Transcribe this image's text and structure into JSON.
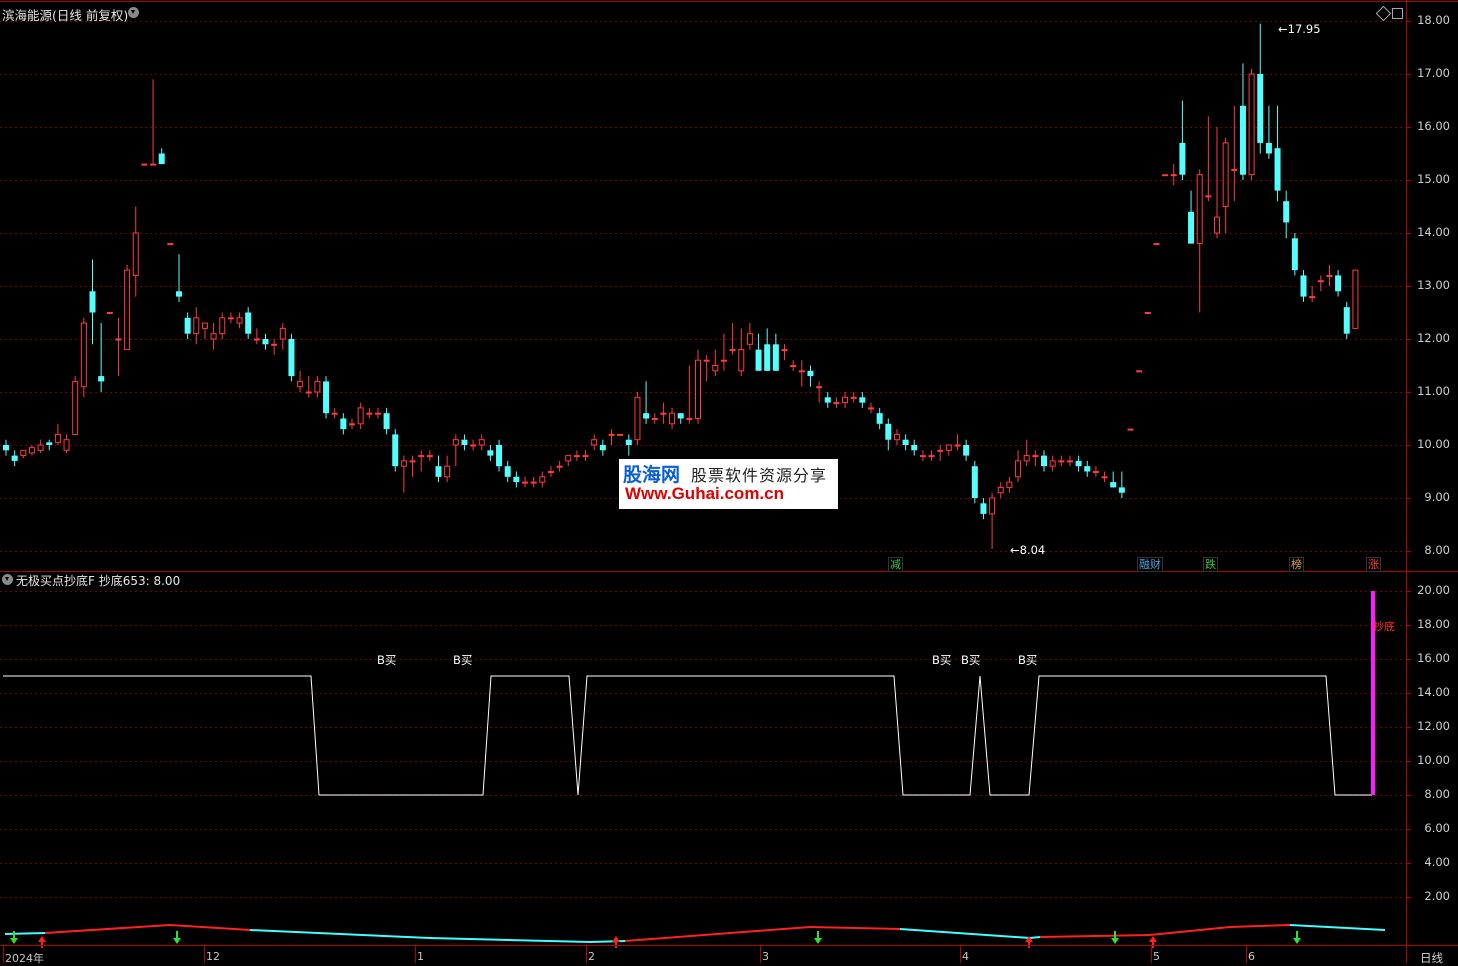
{
  "window": {
    "title": "滨海能源(日线 前复权)",
    "period_label": "日线"
  },
  "price_axis": [
    "18.00",
    "17.00",
    "16.00",
    "15.00",
    "14.00",
    "13.00",
    "12.00",
    "11.00",
    "10.00",
    "9.00",
    "8.00"
  ],
  "indicator_axis": [
    "20.00",
    "18.00",
    "16.00",
    "14.00",
    "12.00",
    "10.00",
    "8.00",
    "6.00",
    "4.00",
    "2.00"
  ],
  "price_annotations": {
    "high": "17.95",
    "low": "8.04"
  },
  "event_tags": [
    {
      "text": "减",
      "color": "#3cc34a"
    },
    {
      "text": "融财",
      "color": "#4fa0e0"
    },
    {
      "text": "跌",
      "color": "#3cc34a"
    },
    {
      "text": "榜",
      "color": "#e0a040"
    },
    {
      "text": "涨",
      "color": "#ff4040"
    }
  ],
  "indicator": {
    "title": "无极买点抄底F  抄底653: 8.00",
    "series_label": "抄底",
    "buy_label": "B买"
  },
  "x_axis_labels": [
    "2024年",
    "12",
    "1",
    "2",
    "3",
    "4",
    "5",
    "6"
  ],
  "watermark": {
    "logo": "股海网",
    "tagline": "股票软件资源分享",
    "url": "Www.Guhai.com.cn"
  },
  "colors": {
    "up": "#ff3b3b",
    "down": "#54ffff",
    "grid": "#7a0000",
    "axis": "#b00000",
    "indicator_line": "#ffffff",
    "signal": "#ff1aff"
  },
  "chart_data": {
    "type": "candlestick",
    "title": "滨海能源(日线 前复权)",
    "ylim": [
      8.0,
      18.0
    ],
    "candles": [
      [
        10.0,
        9.9,
        10.1,
        9.8
      ],
      [
        9.8,
        9.7,
        9.9,
        9.6
      ],
      [
        9.8,
        9.9,
        9.9,
        9.75
      ],
      [
        9.85,
        9.95,
        10.0,
        9.8
      ],
      [
        9.9,
        10.0,
        10.1,
        9.85
      ],
      [
        10.05,
        10.0,
        10.1,
        9.9
      ],
      [
        10.05,
        10.2,
        10.4,
        10.0
      ],
      [
        9.9,
        10.1,
        10.2,
        9.85
      ],
      [
        10.2,
        11.2,
        11.3,
        10.2
      ],
      [
        11.1,
        12.3,
        12.4,
        10.9
      ],
      [
        12.9,
        12.5,
        13.5,
        11.9
      ],
      [
        11.3,
        11.2,
        12.3,
        11.0
      ],
      [
        12.5,
        12.5,
        12.5,
        12.5
      ],
      [
        12.0,
        12.0,
        12.4,
        11.3
      ],
      [
        11.8,
        13.3,
        13.4,
        11.8
      ],
      [
        13.2,
        14.0,
        14.5,
        12.8
      ],
      [
        15.3,
        15.3,
        15.3,
        15.3
      ],
      [
        15.3,
        15.3,
        16.9,
        15.3
      ],
      [
        15.5,
        15.3,
        15.6,
        15.3
      ],
      [
        13.8,
        13.8,
        13.8,
        13.8
      ],
      [
        12.9,
        12.8,
        13.6,
        12.7
      ],
      [
        12.4,
        12.1,
        12.5,
        12.0
      ],
      [
        12.1,
        12.4,
        12.6,
        11.9
      ],
      [
        12.2,
        12.3,
        12.3,
        12.0
      ],
      [
        12.0,
        12.1,
        12.3,
        11.8
      ],
      [
        12.1,
        12.4,
        12.5,
        12.0
      ],
      [
        12.4,
        12.4,
        12.5,
        12.3
      ],
      [
        12.3,
        12.4,
        12.5,
        12.2
      ],
      [
        12.5,
        12.1,
        12.6,
        12.0
      ],
      [
        12.0,
        12.0,
        12.2,
        11.9
      ],
      [
        12.0,
        11.9,
        12.1,
        11.8
      ],
      [
        11.9,
        11.9,
        12.0,
        11.7
      ],
      [
        12.0,
        12.2,
        12.3,
        11.8
      ],
      [
        12.0,
        11.3,
        12.1,
        11.2
      ],
      [
        11.1,
        11.2,
        11.4,
        11.0
      ],
      [
        11.0,
        11.0,
        11.3,
        10.9
      ],
      [
        11.0,
        11.2,
        11.3,
        10.9
      ],
      [
        11.2,
        10.6,
        11.3,
        10.5
      ],
      [
        10.6,
        10.6,
        10.7,
        10.5
      ],
      [
        10.5,
        10.3,
        10.6,
        10.2
      ],
      [
        10.4,
        10.4,
        10.5,
        10.3
      ],
      [
        10.4,
        10.7,
        10.8,
        10.3
      ],
      [
        10.6,
        10.6,
        10.7,
        10.5
      ],
      [
        10.6,
        10.6,
        10.7,
        10.5
      ],
      [
        10.6,
        10.3,
        10.7,
        10.2
      ],
      [
        10.2,
        9.6,
        10.3,
        9.5
      ],
      [
        9.6,
        9.7,
        9.8,
        9.1
      ],
      [
        9.7,
        9.7,
        9.8,
        9.4
      ],
      [
        9.8,
        9.8,
        9.9,
        9.5
      ],
      [
        9.8,
        9.8,
        9.9,
        9.7
      ],
      [
        9.6,
        9.4,
        9.8,
        9.3
      ],
      [
        9.4,
        9.6,
        9.8,
        9.3
      ],
      [
        10.0,
        10.1,
        10.2,
        9.6
      ],
      [
        10.1,
        10.0,
        10.2,
        9.9
      ],
      [
        10.0,
        10.0,
        10.1,
        9.9
      ],
      [
        10.0,
        10.1,
        10.2,
        9.9
      ],
      [
        9.9,
        9.8,
        10.0,
        9.7
      ],
      [
        10.0,
        9.6,
        10.1,
        9.5
      ],
      [
        9.6,
        9.4,
        9.7,
        9.3
      ],
      [
        9.4,
        9.3,
        9.5,
        9.2
      ],
      [
        9.3,
        9.3,
        9.4,
        9.2
      ],
      [
        9.3,
        9.3,
        9.4,
        9.2
      ],
      [
        9.3,
        9.4,
        9.5,
        9.2
      ],
      [
        9.5,
        9.5,
        9.6,
        9.4
      ],
      [
        9.6,
        9.6,
        9.7,
        9.5
      ],
      [
        9.7,
        9.8,
        9.8,
        9.6
      ],
      [
        9.8,
        9.8,
        9.9,
        9.7
      ],
      [
        9.8,
        9.8,
        9.9,
        9.7
      ],
      [
        10.0,
        10.1,
        10.2,
        9.9
      ],
      [
        10.0,
        9.9,
        10.1,
        9.8
      ],
      [
        10.2,
        10.2,
        10.3,
        10.0
      ],
      [
        10.2,
        10.2,
        10.2,
        10.2
      ],
      [
        10.1,
        10.0,
        10.2,
        9.8
      ],
      [
        10.1,
        10.9,
        11.0,
        10.0
      ],
      [
        10.6,
        10.5,
        11.2,
        10.4
      ],
      [
        10.5,
        10.5,
        10.6,
        10.4
      ],
      [
        10.6,
        10.6,
        10.8,
        10.4
      ],
      [
        10.4,
        10.6,
        10.7,
        10.3
      ],
      [
        10.6,
        10.5,
        10.6,
        10.4
      ],
      [
        10.5,
        10.5,
        11.5,
        10.4
      ],
      [
        10.5,
        11.6,
        11.8,
        10.4
      ],
      [
        11.6,
        11.6,
        11.7,
        11.2
      ],
      [
        11.4,
        11.5,
        11.8,
        11.3
      ],
      [
        11.6,
        11.6,
        12.1,
        11.4
      ],
      [
        11.8,
        11.8,
        12.3,
        11.7
      ],
      [
        11.4,
        11.8,
        12.2,
        11.3
      ],
      [
        11.9,
        12.1,
        12.3,
        11.8
      ],
      [
        11.8,
        11.4,
        12.1,
        11.4
      ],
      [
        11.9,
        11.4,
        12.2,
        11.4
      ],
      [
        11.9,
        11.4,
        12.1,
        11.4
      ],
      [
        11.8,
        11.8,
        11.9,
        11.6
      ],
      [
        11.5,
        11.5,
        11.6,
        11.4
      ],
      [
        11.4,
        11.4,
        11.6,
        11.1
      ],
      [
        11.4,
        11.3,
        11.5,
        11.1
      ],
      [
        11.1,
        11.1,
        11.2,
        10.8
      ],
      [
        10.9,
        10.8,
        11.0,
        10.7
      ],
      [
        10.8,
        10.8,
        10.9,
        10.7
      ],
      [
        10.8,
        10.9,
        11.0,
        10.7
      ],
      [
        10.9,
        10.9,
        11.0,
        10.8
      ],
      [
        10.9,
        10.8,
        11.0,
        10.7
      ],
      [
        10.7,
        10.7,
        10.8,
        10.6
      ],
      [
        10.6,
        10.4,
        10.7,
        10.3
      ],
      [
        10.4,
        10.1,
        10.5,
        9.9
      ],
      [
        10.1,
        10.2,
        10.3,
        10.0
      ],
      [
        10.1,
        10.0,
        10.2,
        9.9
      ],
      [
        10.0,
        9.9,
        10.1,
        9.8
      ],
      [
        9.8,
        9.8,
        9.9,
        9.7
      ],
      [
        9.8,
        9.8,
        9.9,
        9.7
      ],
      [
        9.9,
        9.9,
        10.0,
        9.7
      ],
      [
        9.9,
        10.0,
        10.0,
        9.8
      ],
      [
        10.0,
        10.0,
        10.2,
        9.9
      ],
      [
        10.0,
        9.8,
        10.1,
        9.7
      ],
      [
        9.6,
        9.0,
        9.7,
        8.9
      ],
      [
        8.9,
        8.7,
        9.0,
        8.6
      ],
      [
        8.7,
        9.0,
        9.1,
        8.04
      ],
      [
        9.1,
        9.2,
        9.3,
        9.0
      ],
      [
        9.2,
        9.3,
        9.4,
        9.1
      ],
      [
        9.4,
        9.7,
        9.9,
        9.3
      ],
      [
        9.7,
        9.8,
        10.1,
        9.6
      ],
      [
        9.8,
        9.8,
        9.9,
        9.6
      ],
      [
        9.8,
        9.6,
        9.9,
        9.5
      ],
      [
        9.6,
        9.7,
        9.8,
        9.5
      ],
      [
        9.7,
        9.7,
        9.8,
        9.6
      ],
      [
        9.7,
        9.7,
        9.8,
        9.6
      ],
      [
        9.7,
        9.6,
        9.8,
        9.5
      ],
      [
        9.6,
        9.5,
        9.7,
        9.4
      ],
      [
        9.5,
        9.5,
        9.6,
        9.4
      ],
      [
        9.4,
        9.4,
        9.5,
        9.3
      ],
      [
        9.3,
        9.2,
        9.5,
        9.2
      ],
      [
        9.2,
        9.1,
        9.5,
        9.0
      ],
      [
        10.3,
        10.3,
        10.3,
        10.3
      ],
      [
        11.4,
        11.4,
        11.4,
        11.4
      ],
      [
        12.5,
        12.5,
        12.5,
        12.5
      ],
      [
        13.8,
        13.8,
        13.8,
        13.8
      ],
      [
        15.1,
        15.1,
        15.1,
        15.1
      ],
      [
        15.1,
        15.1,
        15.3,
        14.9
      ],
      [
        15.7,
        15.1,
        16.5,
        15.0
      ],
      [
        14.4,
        13.8,
        14.8,
        13.8
      ],
      [
        13.8,
        15.1,
        15.2,
        12.5
      ],
      [
        14.7,
        14.7,
        16.2,
        14.6
      ],
      [
        14.0,
        14.3,
        16.0,
        13.9
      ],
      [
        14.5,
        15.7,
        15.8,
        14.0
      ],
      [
        15.2,
        15.2,
        16.4,
        14.6
      ],
      [
        16.4,
        15.1,
        17.2,
        15.0
      ],
      [
        15.1,
        17.0,
        17.1,
        15.0
      ],
      [
        17.0,
        15.7,
        17.95,
        15.5
      ],
      [
        15.7,
        15.5,
        16.4,
        15.4
      ],
      [
        15.6,
        14.8,
        16.4,
        14.6
      ],
      [
        14.6,
        14.2,
        14.8,
        13.9
      ],
      [
        13.9,
        13.3,
        14.0,
        13.2
      ],
      [
        13.2,
        12.8,
        13.3,
        12.7
      ],
      [
        12.8,
        12.8,
        13.0,
        12.7
      ],
      [
        13.1,
        13.1,
        13.2,
        12.9
      ],
      [
        13.2,
        13.2,
        13.4,
        13.0
      ],
      [
        13.2,
        12.9,
        13.3,
        12.8
      ],
      [
        12.6,
        12.1,
        12.7,
        12.0
      ],
      [
        12.2,
        13.3,
        13.3,
        12.2
      ]
    ]
  }
}
